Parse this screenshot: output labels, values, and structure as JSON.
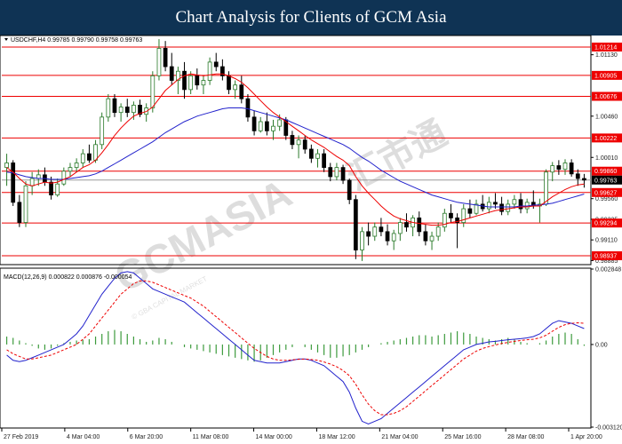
{
  "banner": {
    "title": "Chart Analysis for Clients of GCM Asia",
    "bg_color": "#0f3354"
  },
  "watermark": {
    "text": "GCMASIA",
    "chinese": "汇市通",
    "tagline": "© GBA CAPITAL MARKET"
  },
  "chart_data": [
    {
      "type": "candlestick",
      "symbol_info": "USDCHF,H4  0.99785 0.99790 0.99758 0.99763",
      "ylim": [
        0.9885,
        1.0133
      ],
      "ticks": [
        1.0113,
        1.0046,
        1.0001,
        0.9956,
        0.99335,
        0.9911,
        0.98885
      ],
      "x_labels": [
        "27 Feb 2019",
        "4 Mar 04:00",
        "6 Mar 20:00",
        "11 Mar 08:00",
        "14 Mar 00:00",
        "18 Mar 12:00",
        "21 Mar 04:00",
        "25 Mar 16:00",
        "28 Mar 08:00",
        "1 Apr 20:00"
      ],
      "support_resistance": [
        1.01214,
        1.00905,
        1.00676,
        1.00222,
        0.9986,
        0.99627,
        0.99294,
        0.98937
      ],
      "current_price": 0.99763,
      "level_color": "#ee0000",
      "candle_bull_color": "#2a7a2a",
      "candle_bear_color": "#000000",
      "candles": [
        [
          0.999,
          1.0005,
          0.997,
          0.9995
        ],
        [
          0.9995,
          0.9998,
          0.9948,
          0.9952
        ],
        [
          0.9952,
          0.996,
          0.9925,
          0.993
        ],
        [
          0.993,
          0.9975,
          0.9925,
          0.997
        ],
        [
          0.997,
          0.9985,
          0.996,
          0.9978
        ],
        [
          0.9978,
          0.9988,
          0.997,
          0.9982
        ],
        [
          0.9982,
          0.999,
          0.997,
          0.9974
        ],
        [
          0.9974,
          0.998,
          0.9955,
          0.996
        ],
        [
          0.996,
          0.9978,
          0.9958,
          0.9972
        ],
        [
          0.9972,
          0.999,
          0.997,
          0.9986
        ],
        [
          0.9986,
          0.9995,
          0.998,
          0.999
        ],
        [
          0.999,
          1.0,
          0.9985,
          0.9995
        ],
        [
          0.9995,
          1.001,
          0.999,
          1.0005
        ],
        [
          1.0005,
          1.0015,
          0.9995,
          0.9998
        ],
        [
          0.9998,
          1.002,
          0.9995,
          1.0015
        ],
        [
          1.0015,
          1.005,
          1.001,
          1.0045
        ],
        [
          1.0045,
          1.007,
          1.004,
          1.0065
        ],
        [
          1.0065,
          1.007,
          1.0045,
          1.005
        ],
        [
          1.005,
          1.006,
          1.004,
          1.0056
        ],
        [
          1.0056,
          1.0065,
          1.0045,
          1.005
        ],
        [
          1.005,
          1.0062,
          1.0042,
          1.0058
        ],
        [
          1.0058,
          1.0064,
          1.0045,
          1.0048
        ],
        [
          1.0048,
          1.006,
          1.004,
          1.0055
        ],
        [
          1.0055,
          1.0095,
          1.005,
          1.009
        ],
        [
          1.009,
          1.013,
          1.0085,
          1.012
        ],
        [
          1.012,
          1.0128,
          1.0095,
          1.01
        ],
        [
          1.01,
          1.0115,
          1.008,
          1.0085
        ],
        [
          1.0085,
          1.01,
          1.007,
          1.0095
        ],
        [
          1.0095,
          1.0105,
          1.0065,
          1.0075
        ],
        [
          1.0075,
          1.0095,
          1.007,
          1.009
        ],
        [
          1.009,
          1.0098,
          1.0075,
          1.008
        ],
        [
          1.008,
          1.009,
          1.007,
          1.0085
        ],
        [
          1.0085,
          1.011,
          1.008,
          1.0105
        ],
        [
          1.0105,
          1.0115,
          1.0095,
          1.01
        ],
        [
          1.01,
          1.0108,
          1.0085,
          1.009
        ],
        [
          1.009,
          1.0095,
          1.007,
          1.0075
        ],
        [
          1.0075,
          1.0085,
          1.0065,
          1.008
        ],
        [
          1.008,
          1.009,
          1.006,
          1.0065
        ],
        [
          1.0065,
          1.007,
          1.004,
          1.0045
        ],
        [
          1.0045,
          1.0052,
          1.0025,
          1.003
        ],
        [
          1.003,
          1.0045,
          1.0028,
          1.004
        ],
        [
          1.004,
          1.005,
          1.0025,
          1.003
        ],
        [
          1.003,
          1.0042,
          1.002,
          1.0035
        ],
        [
          1.0035,
          1.0048,
          1.003,
          1.0042
        ],
        [
          1.0042,
          1.0045,
          1.002,
          1.0025
        ],
        [
          1.0025,
          1.003,
          1.001,
          1.0015
        ],
        [
          1.0015,
          1.0025,
          1.0,
          1.002
        ],
        [
          1.002,
          1.0025,
          1.0005,
          1.001
        ],
        [
          1.001,
          1.0015,
          0.9995,
          1.0
        ],
        [
          1.0,
          1.001,
          0.999,
          1.0005
        ],
        [
          1.0005,
          1.001,
          0.9985,
          0.999
        ],
        [
          0.999,
          0.9995,
          0.9975,
          0.998
        ],
        [
          0.998,
          0.9995,
          0.9976,
          0.999
        ],
        [
          0.999,
          0.9993,
          0.9972,
          0.9976
        ],
        [
          0.9976,
          0.9978,
          0.995,
          0.9955
        ],
        [
          0.9955,
          0.996,
          0.989,
          0.99
        ],
        [
          0.99,
          0.9925,
          0.9888,
          0.992
        ],
        [
          0.992,
          0.993,
          0.9905,
          0.9915
        ],
        [
          0.9915,
          0.993,
          0.991,
          0.9925
        ],
        [
          0.9925,
          0.9935,
          0.9915,
          0.992
        ],
        [
          0.992,
          0.9928,
          0.9905,
          0.991
        ],
        [
          0.991,
          0.9922,
          0.99,
          0.9918
        ],
        [
          0.9918,
          0.9935,
          0.991,
          0.993
        ],
        [
          0.993,
          0.994,
          0.992,
          0.9925
        ],
        [
          0.9925,
          0.9938,
          0.9915,
          0.9935
        ],
        [
          0.9935,
          0.9942,
          0.9915,
          0.992
        ],
        [
          0.992,
          0.9928,
          0.9905,
          0.991
        ],
        [
          0.991,
          0.992,
          0.99,
          0.9915
        ],
        [
          0.9915,
          0.993,
          0.991,
          0.9925
        ],
        [
          0.9925,
          0.9945,
          0.992,
          0.994
        ],
        [
          0.994,
          0.995,
          0.993,
          0.9935
        ],
        [
          0.9935,
          0.994,
          0.9902,
          0.993
        ],
        [
          0.993,
          0.995,
          0.9925,
          0.9945
        ],
        [
          0.9945,
          0.9955,
          0.9935,
          0.994
        ],
        [
          0.994,
          0.9955,
          0.9938,
          0.995
        ],
        [
          0.995,
          0.996,
          0.9942,
          0.9945
        ],
        [
          0.9945,
          0.9958,
          0.994,
          0.9952
        ],
        [
          0.9952,
          0.9962,
          0.9945,
          0.995
        ],
        [
          0.995,
          0.9958,
          0.9938,
          0.9942
        ],
        [
          0.9942,
          0.9955,
          0.9938,
          0.995
        ],
        [
          0.995,
          0.996,
          0.9945,
          0.9955
        ],
        [
          0.9955,
          0.9962,
          0.994,
          0.9945
        ],
        [
          0.9945,
          0.9956,
          0.994,
          0.9952
        ],
        [
          0.9952,
          0.9965,
          0.9945,
          0.9948
        ],
        [
          0.9948,
          0.9956,
          0.993,
          0.995
        ],
        [
          0.995,
          0.9988,
          0.9948,
          0.9985
        ],
        [
          0.9985,
          0.9996,
          0.9975,
          0.9992
        ],
        [
          0.9992,
          0.9998,
          0.9982,
          0.9988
        ],
        [
          0.9988,
          0.9999,
          0.9982,
          0.9995
        ],
        [
          0.9995,
          0.9999,
          0.998,
          0.9983
        ],
        [
          0.9983,
          0.9988,
          0.997,
          0.9978
        ],
        [
          0.9978,
          0.9983,
          0.9968,
          0.99763
        ]
      ],
      "ma_fast": [
        0.999,
        0.9985,
        0.9978,
        0.9972,
        0.997,
        0.9972,
        0.9974,
        0.9973,
        0.9974,
        0.9977,
        0.998,
        0.9985,
        0.999,
        0.9993,
        0.9998,
        1.0006,
        1.0015,
        1.0025,
        1.0033,
        1.004,
        1.0046,
        1.0049,
        1.0051,
        1.0056,
        1.0065,
        1.0074,
        1.008,
        1.0086,
        1.009,
        1.0092,
        1.0091,
        1.009,
        1.0091,
        1.0092,
        1.0092,
        1.009,
        1.0087,
        1.0083,
        1.0077,
        1.007,
        1.0063,
        1.0056,
        1.005,
        1.0045,
        1.004,
        1.0035,
        1.003,
        1.0025,
        1.002,
        1.0016,
        1.0012,
        1.0007,
        1.0002,
        0.9998,
        0.9992,
        0.998,
        0.997,
        0.9962,
        0.9955,
        0.9948,
        0.9942,
        0.9937,
        0.9934,
        0.9932,
        0.993,
        0.9929,
        0.9928,
        0.9927,
        0.9927,
        0.9928,
        0.993,
        0.9931,
        0.9933,
        0.9935,
        0.9937,
        0.9939,
        0.9941,
        0.9943,
        0.9944,
        0.9945,
        0.9946,
        0.9947,
        0.9947,
        0.9948,
        0.9948,
        0.9953,
        0.9958,
        0.9962,
        0.9966,
        0.9969,
        0.9971,
        0.9972
      ],
      "ma_slow": [
        0.9985,
        0.9984,
        0.9982,
        0.998,
        0.9979,
        0.9978,
        0.9978,
        0.9977,
        0.9977,
        0.9977,
        0.9978,
        0.9979,
        0.998,
        0.9981,
        0.9983,
        0.9986,
        0.999,
        0.9994,
        0.9998,
        1.0002,
        1.0006,
        1.001,
        1.0014,
        1.0018,
        1.0023,
        1.0028,
        1.0032,
        1.0036,
        1.004,
        1.0043,
        1.0046,
        1.0048,
        1.005,
        1.0052,
        1.0054,
        1.0055,
        1.0055,
        1.0055,
        1.0054,
        1.0052,
        1.005,
        1.0048,
        1.0046,
        1.0044,
        1.0042,
        1.0039,
        1.0036,
        1.0033,
        1.003,
        1.0027,
        1.0024,
        1.0021,
        1.0018,
        1.0015,
        1.0011,
        1.0006,
        1.0001,
        0.9997,
        0.9992,
        0.9987,
        0.9983,
        0.9979,
        0.9975,
        0.9972,
        0.9969,
        0.9966,
        0.9963,
        0.996,
        0.9958,
        0.9956,
        0.9954,
        0.9952,
        0.9951,
        0.995,
        0.9949,
        0.9948,
        0.9947,
        0.9947,
        0.9947,
        0.9947,
        0.9947,
        0.9948,
        0.9948,
        0.9949,
        0.9949,
        0.995,
        0.9951,
        0.9953,
        0.9955,
        0.9957,
        0.9959,
        0.9961
      ],
      "ma_fast_color": "#ee0000",
      "ma_slow_color": "#2222cc"
    },
    {
      "type": "macd",
      "title": "MACD(12,26,9) 0.000822 0.000876 -0.000054",
      "ylim": [
        -0.00312,
        0.002848
      ],
      "ticks": [
        0.002848,
        0.0,
        -0.00312
      ],
      "tick_labels": [
        "0.002848",
        "0.00",
        "-0.003120"
      ],
      "histogram": [
        0.0003,
        0.00025,
        0.00015,
        5e-05,
        -5e-05,
        -0.00015,
        -0.0002,
        -0.00015,
        -5e-05,
        5e-05,
        0.0001,
        0.00015,
        0.00018,
        0.0002,
        0.0003,
        0.0004,
        0.0005,
        0.00055,
        0.0005,
        0.0004,
        0.0003,
        0.0002,
        0.0001,
        0.00015,
        0.00025,
        0.0002,
        0.0001,
        0.0,
        -0.0001,
        -0.00015,
        -0.0002,
        -0.00025,
        -0.0003,
        -0.00035,
        -0.0004,
        -0.00045,
        -0.0005,
        -0.00055,
        -0.0006,
        -0.00065,
        -0.0006,
        -0.0005,
        -0.0004,
        -0.0003,
        -0.0002,
        -0.0001,
        0.0,
        -0.0001,
        -0.0002,
        -0.0003,
        -0.0004,
        -0.0005,
        -0.0005,
        -0.00045,
        -0.0004,
        -0.0003,
        -0.0002,
        -0.0001,
        0.0,
        5e-05,
        0.0001,
        0.00015,
        0.0002,
        0.00025,
        0.0003,
        0.00035,
        0.00035,
        0.0003,
        0.00035,
        0.0004,
        0.00045,
        0.0005,
        0.00045,
        0.0004,
        0.0003,
        0.00025,
        0.0002,
        0.00015,
        0.0002,
        0.00025,
        0.0002,
        0.0001,
        5e-05,
        0.0,
        5e-05,
        0.00015,
        0.0003,
        0.0004,
        0.00045,
        0.0004,
        0.0002,
        -5e-05
      ],
      "macd": [
        -0.0004,
        -0.0006,
        -0.00065,
        -0.0006,
        -0.0005,
        -0.0004,
        -0.0003,
        -0.0002,
        -0.0001,
        0.0,
        0.0002,
        0.0004,
        0.0007,
        0.0011,
        0.0015,
        0.0019,
        0.0022,
        0.0025,
        0.0027,
        0.00275,
        0.0027,
        0.0025,
        0.0023,
        0.0021,
        0.002,
        0.0019,
        0.0018,
        0.0017,
        0.0016,
        0.0014,
        0.0012,
        0.001,
        0.0008,
        0.0006,
        0.0004,
        0.0002,
        0.0,
        -0.0002,
        -0.0004,
        -0.0006,
        -0.00065,
        -0.0007,
        -0.0007,
        -0.0007,
        -0.00065,
        -0.0006,
        -0.00055,
        -0.00055,
        -0.0006,
        -0.0007,
        -0.0008,
        -0.001,
        -0.0012,
        -0.0014,
        -0.0018,
        -0.0024,
        -0.0029,
        -0.003,
        -0.0029,
        -0.0028,
        -0.0026,
        -0.0024,
        -0.0022,
        -0.002,
        -0.0018,
        -0.0016,
        -0.0014,
        -0.0012,
        -0.001,
        -0.0008,
        -0.0006,
        -0.0004,
        -0.0002,
        -0.0001,
        0.0,
        5e-05,
        0.0001,
        0.00012,
        0.00015,
        0.00018,
        0.0002,
        0.00022,
        0.00025,
        0.0003,
        0.0004,
        0.0006,
        0.0008,
        0.0009,
        0.00085,
        0.0008,
        0.0007,
        0.0006
      ],
      "signal": [
        -0.0002,
        -0.00035,
        -0.00045,
        -0.00055,
        -0.00055,
        -0.0005,
        -0.00045,
        -0.0004,
        -0.0003,
        -0.0002,
        -0.0001,
        0.0,
        0.0002,
        0.0004,
        0.0007,
        0.001,
        0.0013,
        0.0016,
        0.0019,
        0.0021,
        0.0023,
        0.0024,
        0.0024,
        0.00235,
        0.00225,
        0.00215,
        0.00205,
        0.00195,
        0.00185,
        0.00175,
        0.0016,
        0.00145,
        0.00125,
        0.00105,
        0.00085,
        0.00065,
        0.00045,
        0.00025,
        5e-05,
        -0.00015,
        -0.0003,
        -0.00045,
        -0.00055,
        -0.0006,
        -0.0006,
        -0.00058,
        -0.00056,
        -0.00055,
        -0.00057,
        -0.0006,
        -0.00066,
        -0.00074,
        -0.00084,
        -0.00098,
        -0.00118,
        -0.0015,
        -0.0019,
        -0.00225,
        -0.0025,
        -0.00265,
        -0.00265,
        -0.0026,
        -0.0025,
        -0.00235,
        -0.00215,
        -0.00195,
        -0.00175,
        -0.00155,
        -0.00135,
        -0.00115,
        -0.00095,
        -0.00075,
        -0.00055,
        -0.0004,
        -0.00025,
        -0.00015,
        -8e-05,
        -2e-05,
        4e-05,
        8e-05,
        0.00012,
        0.00015,
        0.00018,
        0.0002,
        0.00025,
        0.00035,
        0.0005,
        0.00065,
        0.00075,
        0.0008,
        0.00082,
        0.0008
      ],
      "macd_color": "#2222cc",
      "signal_color": "#ee0000",
      "hist_color": "#3d9b3d"
    }
  ]
}
